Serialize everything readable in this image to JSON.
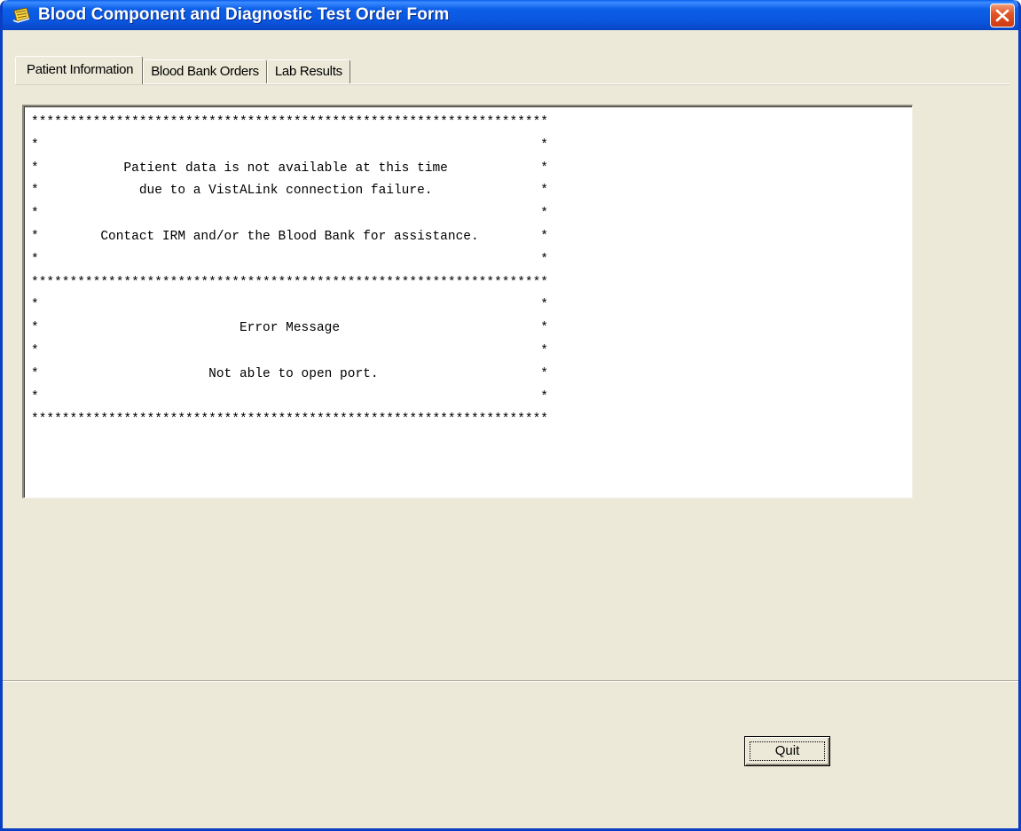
{
  "window": {
    "title": "Blood Component and Diagnostic Test Order Form"
  },
  "tabs": [
    {
      "label": "Patient Information",
      "active": true
    },
    {
      "label": "Blood Bank Orders",
      "active": false
    },
    {
      "label": "Lab Results",
      "active": false
    }
  ],
  "message": {
    "lines": [
      "*******************************************************************",
      "*                                                                 *",
      "*           Patient data is not available at this time            *",
      "*             due to a VistALink connection failure.              *",
      "*                                                                 *",
      "*        Contact IRM and/or the Blood Bank for assistance.        *",
      "*                                                                 *",
      "*******************************************************************",
      "*                                                                 *",
      "*                          Error Message                          *",
      "*                                                                 *",
      "*                      Not able to open port.                     *",
      "*                                                                 *",
      "*******************************************************************"
    ]
  },
  "buttons": {
    "quit_label": "Quit"
  },
  "colors": {
    "titlebar": "#0a56de",
    "window_bg": "#ece9d8",
    "close_button": "#e2562a"
  },
  "icons": {
    "app": "form-icon",
    "close": "close-icon"
  }
}
